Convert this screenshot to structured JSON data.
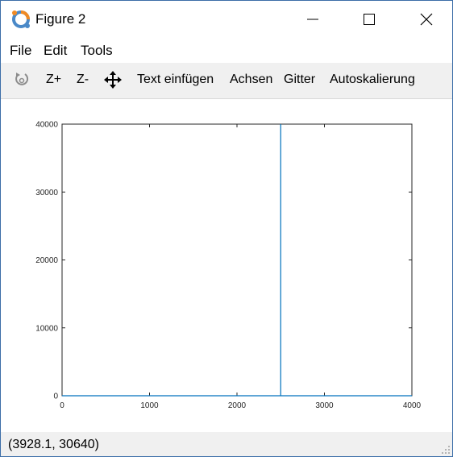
{
  "window": {
    "title": "Figure 2",
    "accent_color": "#3c6ea8"
  },
  "menu": {
    "items": [
      "File",
      "Edit",
      "Tools"
    ]
  },
  "toolbar": {
    "rotate_icon": "rotate-icon",
    "zoom_in_label": "Z+",
    "zoom_out_label": "Z-",
    "pan_icon": "pan-arrows-icon",
    "insert_text_label": "Text einfügen",
    "axes_label": "Achsen",
    "grid_label": "Gitter",
    "autoscale_label": "Autoskalierung"
  },
  "status": {
    "coordinates": "(3928.1, 30640)"
  },
  "chart_data": {
    "type": "line",
    "title": "",
    "xlabel": "",
    "ylabel": "",
    "xlim": [
      0,
      4000
    ],
    "ylim": [
      0,
      40000
    ],
    "xticks": [
      0,
      1000,
      2000,
      3000,
      4000
    ],
    "yticks": [
      0,
      10000,
      20000,
      30000,
      40000
    ],
    "xtick_labels": [
      "0",
      "1000",
      "2000",
      "3000",
      "4000"
    ],
    "ytick_labels": [
      "0",
      "10000",
      "20000",
      "30000",
      "40000"
    ],
    "grid": false,
    "series": [
      {
        "color": "#0072bd",
        "x": [
          0,
          2500,
          2500,
          2500,
          4000
        ],
        "y": [
          0,
          0,
          40000,
          0,
          0
        ]
      }
    ]
  }
}
